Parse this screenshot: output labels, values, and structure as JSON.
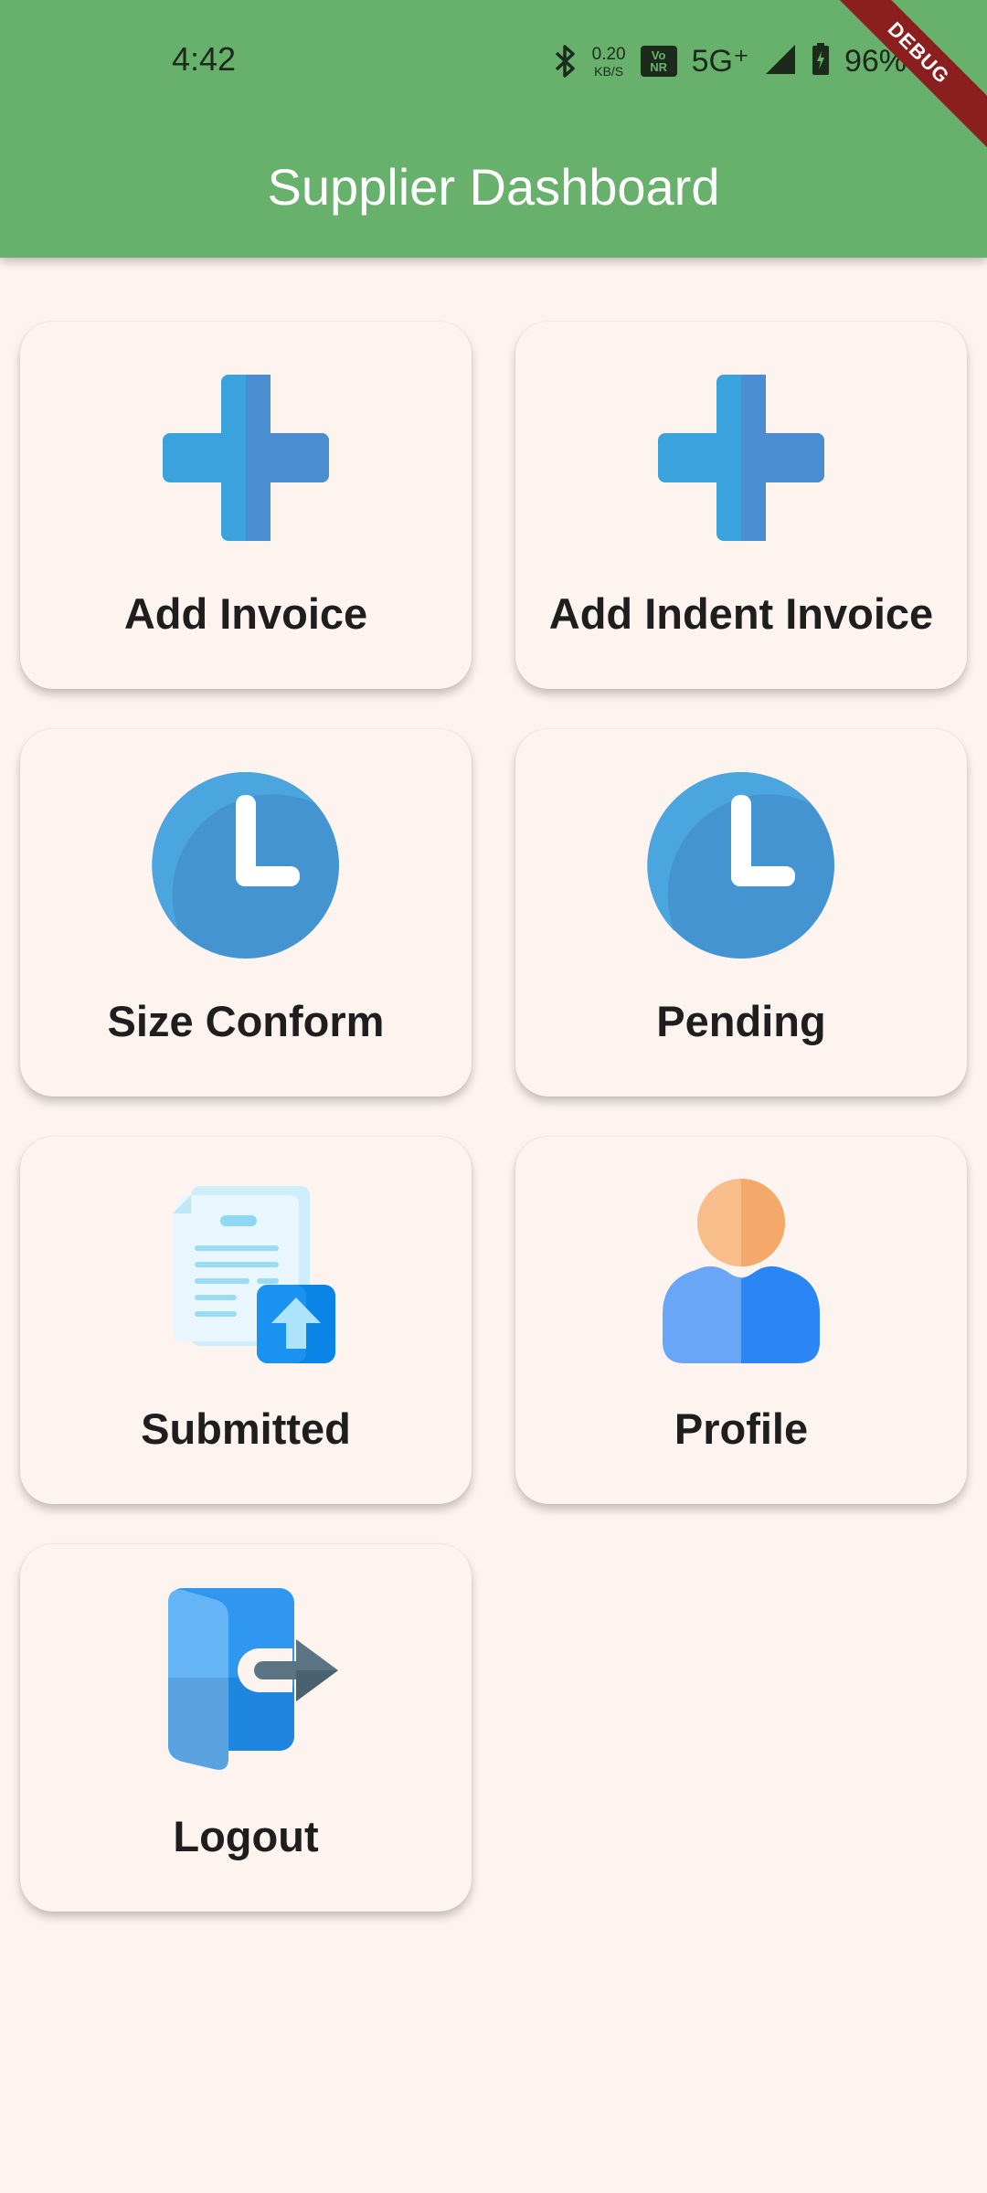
{
  "status_bar": {
    "time": "4:42",
    "net_speed_value": "0.20",
    "net_speed_unit": "KB/S",
    "vonr_top": "Vo",
    "vonr_bottom": "NR",
    "network": "5G⁺",
    "battery": "96%",
    "icons": [
      "bluetooth-icon",
      "signal-icon",
      "battery-charging-icon"
    ]
  },
  "debug_banner": "DEBUG",
  "appbar": {
    "title": "Supplier Dashboard",
    "color": "#68b16c"
  },
  "tiles": [
    {
      "label": "Add Invoice",
      "icon": "plus-icon"
    },
    {
      "label": "Add Indent Invoice",
      "icon": "plus-icon"
    },
    {
      "label": "Size Conform",
      "icon": "clock-icon"
    },
    {
      "label": "Pending",
      "icon": "clock-icon"
    },
    {
      "label": "Submitted",
      "icon": "document-upload-icon"
    },
    {
      "label": "Profile",
      "icon": "user-icon"
    },
    {
      "label": "Logout",
      "icon": "logout-door-icon"
    }
  ]
}
